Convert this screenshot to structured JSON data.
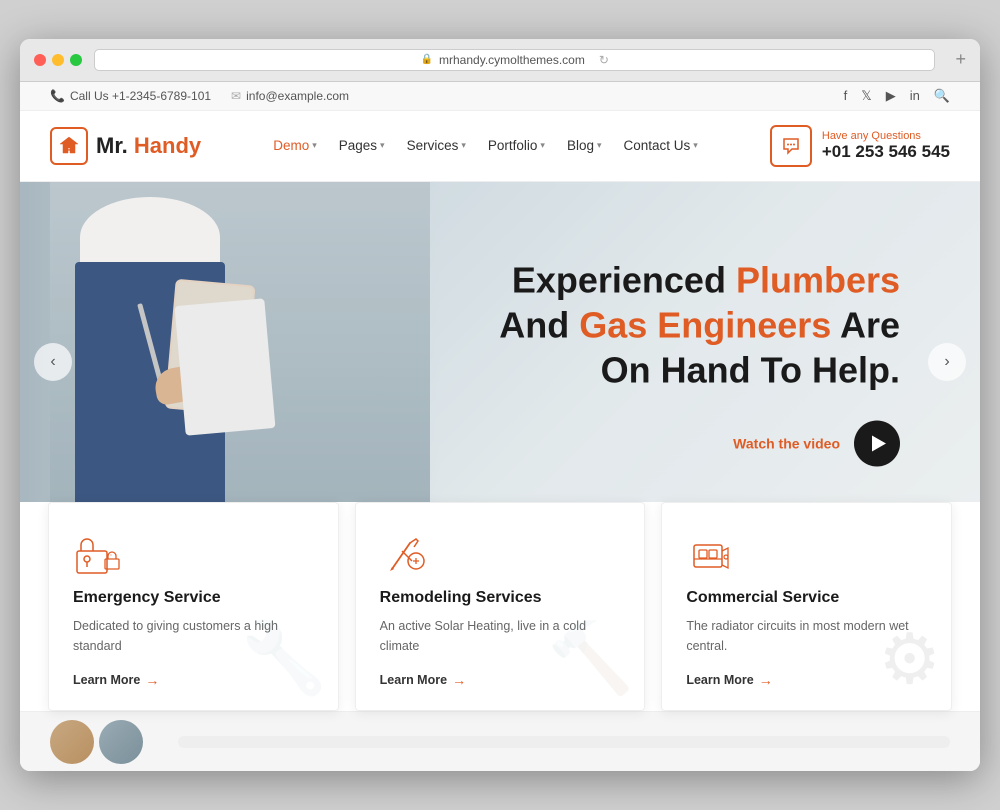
{
  "browser": {
    "url": "mrhandy.cymolthemes.com",
    "reload_icon": "↻",
    "plus_icon": "+"
  },
  "topbar": {
    "phone_icon": "📞",
    "phone": "Call Us +1-2345-6789-101",
    "email_icon": "✉",
    "email": "info@example.com",
    "socials": [
      "f",
      "t",
      "▶",
      "in",
      "🔍"
    ]
  },
  "header": {
    "logo_text_mr": "Mr.",
    "logo_text_handy": " Handy",
    "nav_items": [
      {
        "label": "Demo",
        "active": true
      },
      {
        "label": "Pages",
        "active": false
      },
      {
        "label": "Services",
        "active": false
      },
      {
        "label": "Portfolio",
        "active": false
      },
      {
        "label": "Blog",
        "active": false
      },
      {
        "label": "Contact Us",
        "active": false
      }
    ],
    "contact_question": "Have any Questions",
    "contact_phone": "+01 253 546 545"
  },
  "hero": {
    "line1": "Experienced ",
    "line1_accent": "Plumbers",
    "line2_start": "And ",
    "line2_accent": "Gas Engineers",
    "line2_end": " Are",
    "line3": "On Hand To Help.",
    "watch_video": "Watch the video",
    "carousel_left": "‹",
    "carousel_right": "›"
  },
  "services": [
    {
      "title": "Emergency Service",
      "desc": "Dedicated to giving customers a high standard",
      "learn_more": "Learn More"
    },
    {
      "title": "Remodeling Services",
      "desc": "An active Solar Heating, live in a cold climate",
      "learn_more": "Learn More"
    },
    {
      "title": "Commercial Service",
      "desc": "The radiator circuits in most modern wet central.",
      "learn_more": "Learn More"
    }
  ]
}
